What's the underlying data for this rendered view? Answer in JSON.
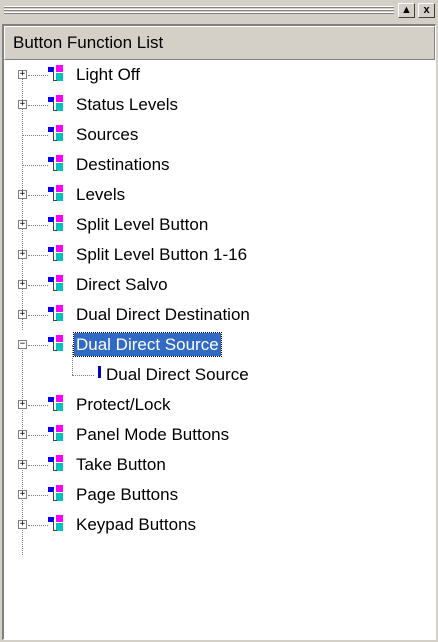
{
  "window": {
    "up_button": "▲",
    "close_button": "x"
  },
  "tree_header": "Button Function List",
  "tree": {
    "items": [
      {
        "label": "Light Off",
        "expander": "+"
      },
      {
        "label": "Status Levels",
        "expander": "+"
      },
      {
        "label": "Sources",
        "expander": ""
      },
      {
        "label": "Destinations",
        "expander": ""
      },
      {
        "label": "Levels",
        "expander": "+"
      },
      {
        "label": "Split Level Button",
        "expander": "+"
      },
      {
        "label": "Split Level Button 1-16",
        "expander": "+"
      },
      {
        "label": "Direct Salvo",
        "expander": "+"
      },
      {
        "label": "Dual Direct Destination",
        "expander": "+"
      },
      {
        "label": "Dual Direct Source",
        "expander": "−",
        "selected": true
      },
      {
        "label": "Dual Direct Source",
        "child": true
      },
      {
        "label": "Protect/Lock",
        "expander": "+"
      },
      {
        "label": "Panel Mode Buttons",
        "expander": "+"
      },
      {
        "label": "Take Button",
        "expander": "+"
      },
      {
        "label": "Page Buttons",
        "expander": "+"
      },
      {
        "label": "Keypad Buttons",
        "expander": "+"
      }
    ]
  },
  "colors": {
    "selection": "#316ac5",
    "icon_blue": "#0000ff",
    "icon_magenta": "#ff00ff",
    "icon_cyan": "#00c0c0"
  }
}
